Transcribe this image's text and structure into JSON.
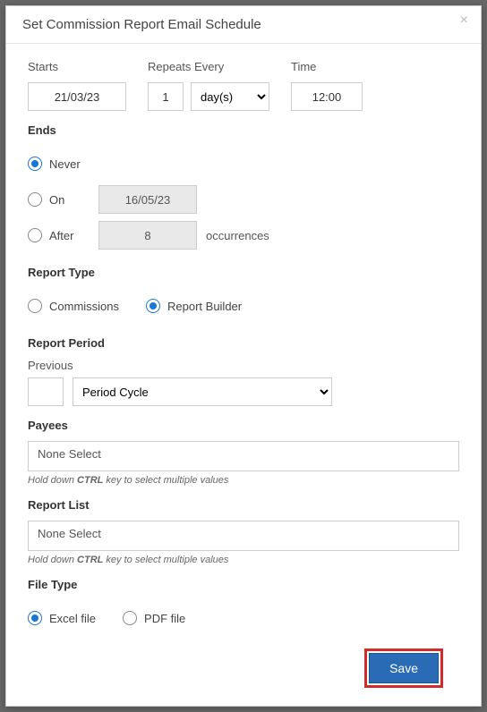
{
  "modal": {
    "title": "Set Commission Report Email Schedule"
  },
  "starts": {
    "label": "Starts",
    "value": "21/03/23"
  },
  "repeats": {
    "label": "Repeats Every",
    "count": "1",
    "unit": "day(s)"
  },
  "time": {
    "label": "Time",
    "value": "12:00"
  },
  "ends": {
    "label": "Ends",
    "selected": "never",
    "never_label": "Never",
    "on_label": "On",
    "on_date": "16/05/23",
    "after_label": "After",
    "after_count": "8",
    "occurrences_label": "occurrences"
  },
  "report_type": {
    "label": "Report Type",
    "selected": "report_builder",
    "commissions_label": "Commissions",
    "report_builder_label": "Report Builder"
  },
  "report_period": {
    "label": "Report Period",
    "previous_label": "Previous",
    "count": "",
    "cycle": "Period Cycle"
  },
  "payees": {
    "label": "Payees",
    "value": "None Select",
    "hint_prefix": "Hold down ",
    "hint_bold": "CTRL",
    "hint_suffix": " key to select multiple values"
  },
  "report_list": {
    "label": "Report List",
    "value": "None Select",
    "hint_prefix": "Hold down ",
    "hint_bold": "CTRL",
    "hint_suffix": " key to select multiple values"
  },
  "file_type": {
    "label": "File Type",
    "selected": "excel",
    "excel_label": "Excel file",
    "pdf_label": "PDF file"
  },
  "buttons": {
    "save": "Save"
  }
}
